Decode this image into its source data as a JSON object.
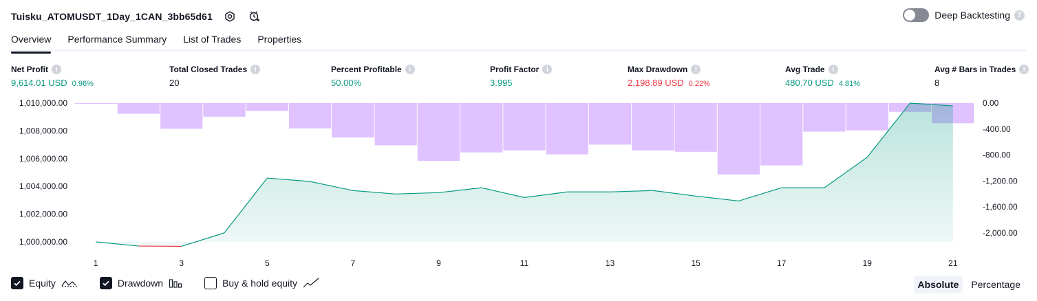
{
  "header": {
    "strategy_name": "Tuisku_ATOMUSDT_1Day_1CAN_3bb65d61",
    "settings_icon": "settings-icon",
    "add_alert_icon": "add-alert-icon",
    "deep_backtesting_label": "Deep Backtesting",
    "deep_backtesting_info": "?"
  },
  "tabs": [
    {
      "label": "Overview"
    },
    {
      "label": "Performance Summary"
    },
    {
      "label": "List of Trades"
    },
    {
      "label": "Properties"
    }
  ],
  "metrics": [
    {
      "label": "Net Profit",
      "value": "9,614.01 USD",
      "pct": "0.96%",
      "tone": "pos"
    },
    {
      "label": "Total Closed Trades",
      "value": "20",
      "pct": "",
      "tone": "neutral"
    },
    {
      "label": "Percent Profitable",
      "value": "50.00%",
      "pct": "",
      "tone": "pos"
    },
    {
      "label": "Profit Factor",
      "value": "3.995",
      "pct": "",
      "tone": "pos"
    },
    {
      "label": "Max Drawdown",
      "value": "2,198.89 USD",
      "pct": "0.22%",
      "tone": "neg"
    },
    {
      "label": "Avg Trade",
      "value": "480.70 USD",
      "pct": "4.81%",
      "tone": "pos"
    },
    {
      "label": "Avg # Bars in Trades",
      "value": "8",
      "pct": "",
      "tone": "neutral"
    }
  ],
  "chart_data": {
    "type": "line",
    "x": [
      1,
      2,
      3,
      4,
      5,
      6,
      7,
      8,
      9,
      10,
      11,
      12,
      13,
      14,
      15,
      16,
      17,
      18,
      19,
      20,
      21
    ],
    "x_ticks": [
      "1",
      "3",
      "5",
      "7",
      "9",
      "11",
      "13",
      "15",
      "17",
      "19",
      "21"
    ],
    "series": [
      {
        "name": "Equity",
        "axis": "left",
        "color_up": "#089981",
        "color_down": "#f23645",
        "values": [
          1000000,
          999700,
          999680,
          1000650,
          1004600,
          1004350,
          1003700,
          1003450,
          1003550,
          1003900,
          1003200,
          1003600,
          1003600,
          1003700,
          1003300,
          1002950,
          1003900,
          1003900,
          1006100,
          1010000,
          1009800
        ]
      },
      {
        "name": "Drawdown",
        "axis": "right",
        "type": "bar",
        "color": "#d1a8ff",
        "values": [
          -5,
          -165,
          -395,
          -210,
          -120,
          -390,
          -530,
          -650,
          -890,
          -760,
          -730,
          -790,
          -640,
          -730,
          -750,
          -1100,
          -960,
          -440,
          -420,
          -135,
          -310
        ]
      }
    ],
    "y_left_ticks": [
      "1,010,000.00",
      "1,008,000.00",
      "1,006,000.00",
      "1,004,000.00",
      "1,002,000.00",
      "1,000,000.00"
    ],
    "y_left_range": [
      999000,
      1010000
    ],
    "y_right_ticks": [
      "0.00",
      "-400.00",
      "-800.00",
      "-1,200.00",
      "-1,600.00",
      "-2,000.00"
    ],
    "y_right_range": [
      -2200,
      0
    ],
    "grid": false
  },
  "legend": {
    "equity_label": "Equity",
    "drawdown_label": "Drawdown",
    "buy_hold_label": "Buy & hold equity"
  },
  "mode": {
    "absolute_label": "Absolute",
    "percentage_label": "Percentage"
  }
}
